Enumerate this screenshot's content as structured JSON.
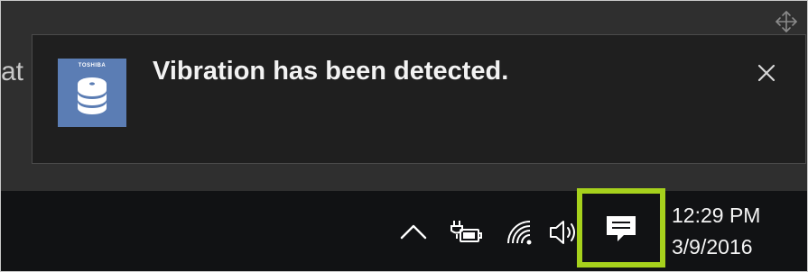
{
  "background": {
    "partial_text": "at"
  },
  "toast": {
    "app_brand": "TOSHIBA",
    "title": "Vibration has been detected."
  },
  "taskbar": {
    "clock_time": "12:29 PM",
    "clock_date": "3/9/2016"
  },
  "colors": {
    "toast_background": "#1f1f1f",
    "taskbar_background": "#111214",
    "app_icon_background": "#5b7db4",
    "highlight_box": "#a6d11c"
  },
  "icons": [
    "move-arrows-icon",
    "hard-disk-icon",
    "close-icon",
    "chevron-up-icon",
    "battery-charging-icon",
    "wifi-icon",
    "volume-icon",
    "action-center-icon"
  ]
}
